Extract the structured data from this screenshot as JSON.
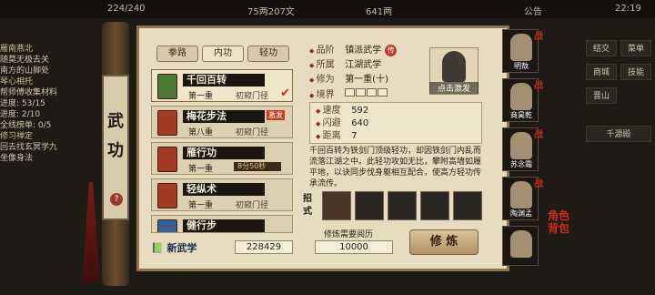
{
  "topbar": {
    "energy": "224/240",
    "silver": "75两207文",
    "coins": "641两",
    "notice": "公告",
    "clock": "22:19"
  },
  "quests": [
    {
      "title": "雁南燕北",
      "lines": [
        "随莫无极去关",
        "南方的山脚处"
      ]
    },
    {
      "title": "琴心相托",
      "lines": [
        "帮师傅收集材料",
        "进度: 53/15",
        "进度: 2/10",
        "全线榜单: 0/5"
      ]
    },
    {
      "title": "修习禅定",
      "lines": [
        "回去找玄冥学九",
        "坐像身法"
      ]
    }
  ],
  "right_menu": [
    "结交",
    "菜单",
    "商城",
    "技能",
    "晋山",
    "千源殿"
  ],
  "side_title": "武功",
  "side_help": "?",
  "tabs": [
    "拳路",
    "内功",
    "轻功"
  ],
  "skills": [
    {
      "name": "千回百转",
      "level": "第一重",
      "state": "初窥门径",
      "checked": true
    },
    {
      "name": "梅花步法",
      "level": "第八重",
      "state": "初窥门径",
      "badge": "激发"
    },
    {
      "name": "雁行功",
      "level": "第一重",
      "state": "8分50秒"
    },
    {
      "name": "轻纵术",
      "level": "第一重",
      "state": "初窥门径"
    },
    {
      "name": "健行步",
      "level": "",
      "state": ""
    }
  ],
  "new_skill_label": "新武学",
  "new_skill_value": "228429",
  "info": {
    "grade_label": "品阶",
    "grade": "镇派武学",
    "tier": "传",
    "belong_label": "所属",
    "belong": "江湖武学",
    "cult_label": "修为",
    "cult": "第一重(十)",
    "realm_label": "境界"
  },
  "portrait_label": "点击激发",
  "stats": [
    {
      "label": "速度",
      "value": "592"
    },
    {
      "label": "闪避",
      "value": "640"
    },
    {
      "label": "距离",
      "value": "7"
    }
  ],
  "description": "千回百转为铁剑门顶级轻功，却因铁剑门内乱而流落江湖之中。此轻功攻如无比，攀附高墙如履平地，以诀同步伐身躯相互配合，使高方轻功传承流传。",
  "moves_label": "招式",
  "cost_label": "修炼需要阅历",
  "cost_value": "10000",
  "train_label": "修 炼",
  "party": [
    {
      "name": "明敖",
      "mark": "战"
    },
    {
      "name": "商昊乾",
      "mark": "战"
    },
    {
      "name": "苏念霜",
      "mark": "战"
    },
    {
      "name": "陶渊孟",
      "mark": "战"
    },
    {
      "name": "",
      "mark": ""
    }
  ],
  "corner_text": [
    "角色",
    "背包"
  ]
}
